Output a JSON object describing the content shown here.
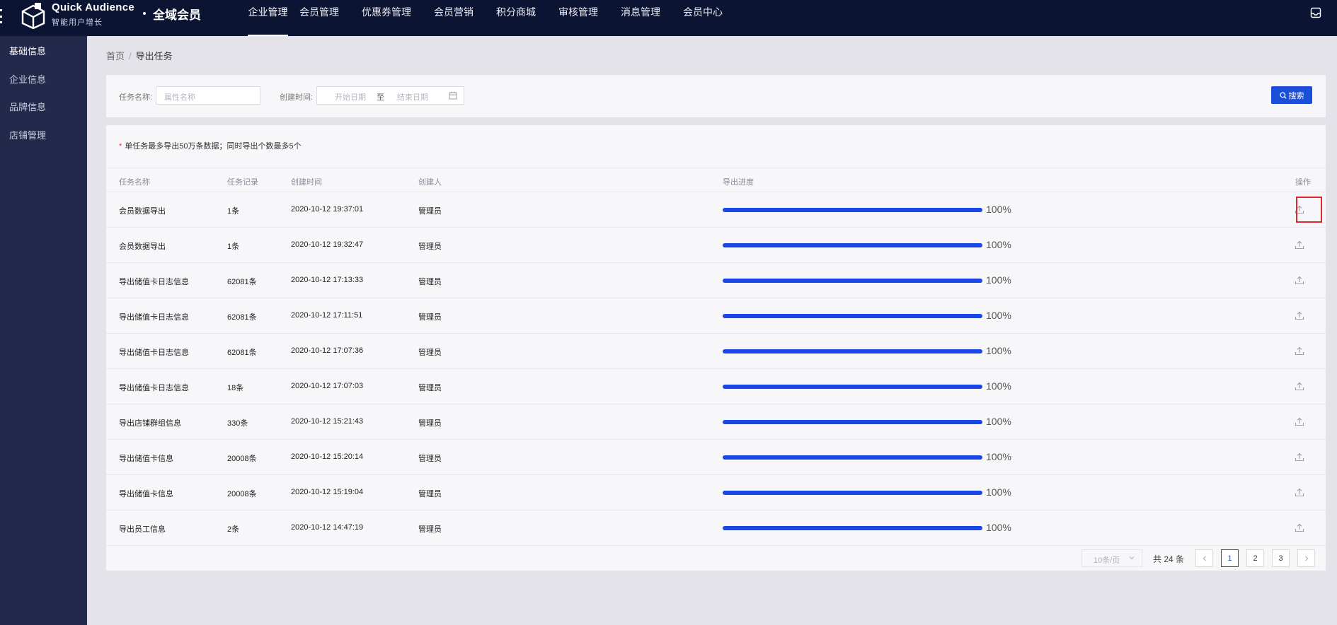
{
  "brand": {
    "name": "Quick Audience",
    "subtitle": "智能用户增长",
    "product": "全域会员"
  },
  "topnav": [
    "企业管理",
    "会员管理",
    "优惠券管理",
    "会员营销",
    "积分商城",
    "审核管理",
    "消息管理",
    "会员中心"
  ],
  "topnav_active": "企业管理",
  "sidebar": {
    "items": [
      "基础信息",
      "企业信息",
      "品牌信息",
      "店铺管理"
    ]
  },
  "breadcrumb": {
    "home": "首页",
    "separator": "/",
    "current": "导出任务"
  },
  "filters": {
    "task_name_label": "任务名称:",
    "task_name_placeholder": "属性名称",
    "created_label": "创建时间:",
    "start_placeholder": "开始日期",
    "range_sep": "至",
    "end_placeholder": "结束日期",
    "search_label": "搜索"
  },
  "notice": {
    "star": "*",
    "text": "单任务最多导出50万条数据；同时导出个数最多5个"
  },
  "table": {
    "columns": [
      "任务名称",
      "任务记录",
      "创建时间",
      "创建人",
      "导出进度",
      "操作"
    ],
    "rows": [
      {
        "name": "会员数据导出",
        "records": "1条",
        "created": "2020-10-12 19:37:01",
        "creator": "管理员",
        "progress": 100,
        "progress_text": "100%"
      },
      {
        "name": "会员数据导出",
        "records": "1条",
        "created": "2020-10-12 19:32:47",
        "creator": "管理员",
        "progress": 100,
        "progress_text": "100%"
      },
      {
        "name": "导出储值卡日志信息",
        "records": "62081条",
        "created": "2020-10-12 17:13:33",
        "creator": "管理员",
        "progress": 100,
        "progress_text": "100%"
      },
      {
        "name": "导出储值卡日志信息",
        "records": "62081条",
        "created": "2020-10-12 17:11:51",
        "creator": "管理员",
        "progress": 100,
        "progress_text": "100%"
      },
      {
        "name": "导出储值卡日志信息",
        "records": "62081条",
        "created": "2020-10-12 17:07:36",
        "creator": "管理员",
        "progress": 100,
        "progress_text": "100%"
      },
      {
        "name": "导出储值卡日志信息",
        "records": "18条",
        "created": "2020-10-12 17:07:03",
        "creator": "管理员",
        "progress": 100,
        "progress_text": "100%"
      },
      {
        "name": "导出店铺群组信息",
        "records": "330条",
        "created": "2020-10-12 15:21:43",
        "creator": "管理员",
        "progress": 100,
        "progress_text": "100%"
      },
      {
        "name": "导出储值卡信息",
        "records": "20008条",
        "created": "2020-10-12 15:20:14",
        "creator": "管理员",
        "progress": 100,
        "progress_text": "100%"
      },
      {
        "name": "导出储值卡信息",
        "records": "20008条",
        "created": "2020-10-12 15:19:04",
        "creator": "管理员",
        "progress": 100,
        "progress_text": "100%"
      },
      {
        "name": "导出员工信息",
        "records": "2条",
        "created": "2020-10-12 14:47:19",
        "creator": "管理员",
        "progress": 100,
        "progress_text": "100%"
      }
    ]
  },
  "pagination": {
    "page_size": "10条/页",
    "total": "共 24 条",
    "pages": [
      "1",
      "2",
      "3"
    ],
    "current": "1"
  },
  "icons": {
    "search": "search-icon",
    "calendar": "calendar-icon",
    "export": "upload-icon",
    "mailbox": "inbox-icon"
  },
  "colors": {
    "topbar": "#0b1432",
    "sidebar": "#22294a",
    "accent": "#1c4fd9",
    "progress": "#1747e8",
    "highlight": "#e0282e"
  }
}
